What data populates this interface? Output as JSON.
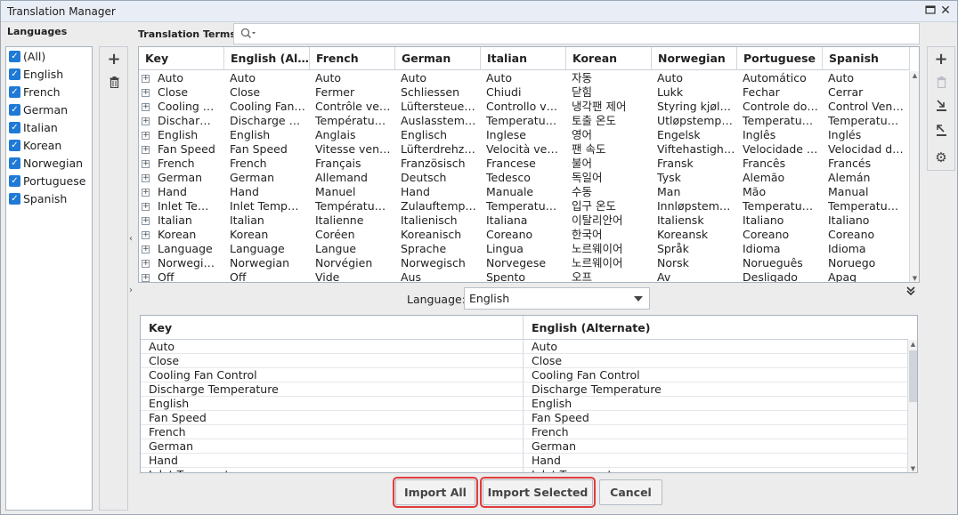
{
  "window": {
    "title": "Translation Manager"
  },
  "languages": {
    "heading": "Languages",
    "items": [
      {
        "label": "(All)",
        "checked": true
      },
      {
        "label": "English",
        "checked": true
      },
      {
        "label": "French",
        "checked": true
      },
      {
        "label": "German",
        "checked": true
      },
      {
        "label": "Italian",
        "checked": true
      },
      {
        "label": "Korean",
        "checked": true
      },
      {
        "label": "Norwegian",
        "checked": true
      },
      {
        "label": "Portuguese",
        "checked": true
      },
      {
        "label": "Spanish",
        "checked": true
      }
    ]
  },
  "terms": {
    "heading": "Translation Terms",
    "search_placeholder": "",
    "columns": [
      "Key",
      "English (Al…",
      "French",
      "German",
      "Italian",
      "Korean",
      "Norwegian",
      "Portuguese",
      "Spanish"
    ],
    "rows": [
      [
        "Auto",
        "Auto",
        "Auto",
        "Auto",
        "Auto",
        "자동",
        "Auto",
        "Automático",
        "Auto"
      ],
      [
        "Close",
        "Close",
        "Fermer",
        "Schliessen",
        "Chiudi",
        "닫힘",
        "Lukk",
        "Fechar",
        "Cerrar"
      ],
      [
        "Cooling …",
        "Cooling Fan…",
        "Contrôle ve…",
        "Lüftersteue…",
        "Controllo v…",
        "냉각팬 제어",
        "Styring kjøl…",
        "Controle do…",
        "Control Ven…"
      ],
      [
        "Dischar…",
        "Discharge …",
        "Températu…",
        "Auslasstem…",
        "Temperatu…",
        "토출 온도",
        "Utløpstemp…",
        "Temperatu…",
        "Temperatu…"
      ],
      [
        "English",
        "English",
        "Anglais",
        "Englisch",
        "Inglese",
        "영어",
        "Engelsk",
        "Inglês",
        "Inglés"
      ],
      [
        "Fan Speed",
        "Fan Speed",
        "Vitesse ven…",
        "Lüfterdrehz…",
        "Velocità ve…",
        "팬 속도",
        "Viftehastigh…",
        "Velocidade …",
        "Velocidad d…"
      ],
      [
        "French",
        "French",
        "Français",
        "Französisch",
        "Francese",
        "불어",
        "Fransk",
        "Francês",
        "Francés"
      ],
      [
        "German",
        "German",
        "Allemand",
        "Deutsch",
        "Tedesco",
        "독일어",
        "Tysk",
        "Alemão",
        "Alemán"
      ],
      [
        "Hand",
        "Hand",
        "Manuel",
        "Hand",
        "Manuale",
        "수동",
        "Man",
        "Mão",
        "Manual"
      ],
      [
        "Inlet Te…",
        "Inlet Temp…",
        "Températu…",
        "Zulauftemp…",
        "Temperatu…",
        "입구 온도",
        "Innløpstem…",
        "Temperatu…",
        "Temperatu…"
      ],
      [
        "Italian",
        "Italian",
        "Italienne",
        "Italienisch",
        "Italiana",
        "이탈리안어",
        "Italiensk",
        "Italiano",
        "Italiano"
      ],
      [
        "Korean",
        "Korean",
        "Coréen",
        "Koreanisch",
        "Coreano",
        "한국어",
        "Koreansk",
        "Coreano",
        "Coreano"
      ],
      [
        "Language",
        "Language",
        "Langue",
        "Sprache",
        "Lingua",
        "노르웨이어",
        "Språk",
        "Idioma",
        "Idioma"
      ],
      [
        "Norwegi…",
        "Norwegian",
        "Norvégien",
        "Norwegisch",
        "Norvegese",
        "노르웨이어",
        "Norsk",
        "Norueguês",
        "Noruego"
      ],
      [
        "Off",
        "Off",
        "Vide",
        "Aus",
        "Spento",
        "오프",
        "Av",
        "Desligado",
        "Apag"
      ]
    ]
  },
  "language_picker": {
    "label": "Language:",
    "value": "English"
  },
  "translations": {
    "columns": [
      "Key",
      "English (Alternate)"
    ],
    "rows": [
      [
        "Auto",
        "Auto"
      ],
      [
        "Close",
        "Close"
      ],
      [
        "Cooling Fan Control",
        "Cooling Fan Control"
      ],
      [
        "Discharge Temperature",
        "Discharge Temperature"
      ],
      [
        "English",
        "English"
      ],
      [
        "Fan Speed",
        "Fan Speed"
      ],
      [
        "French",
        "French"
      ],
      [
        "German",
        "German"
      ],
      [
        "Hand",
        "Hand"
      ],
      [
        "Inlet Temperature",
        "Inlet Temperature"
      ]
    ]
  },
  "buttons": {
    "import_all": "Import All",
    "import_selected": "Import Selected",
    "cancel": "Cancel"
  },
  "colors": {
    "highlight": "#e23b3b",
    "checkbox": "#1f7ad6"
  }
}
